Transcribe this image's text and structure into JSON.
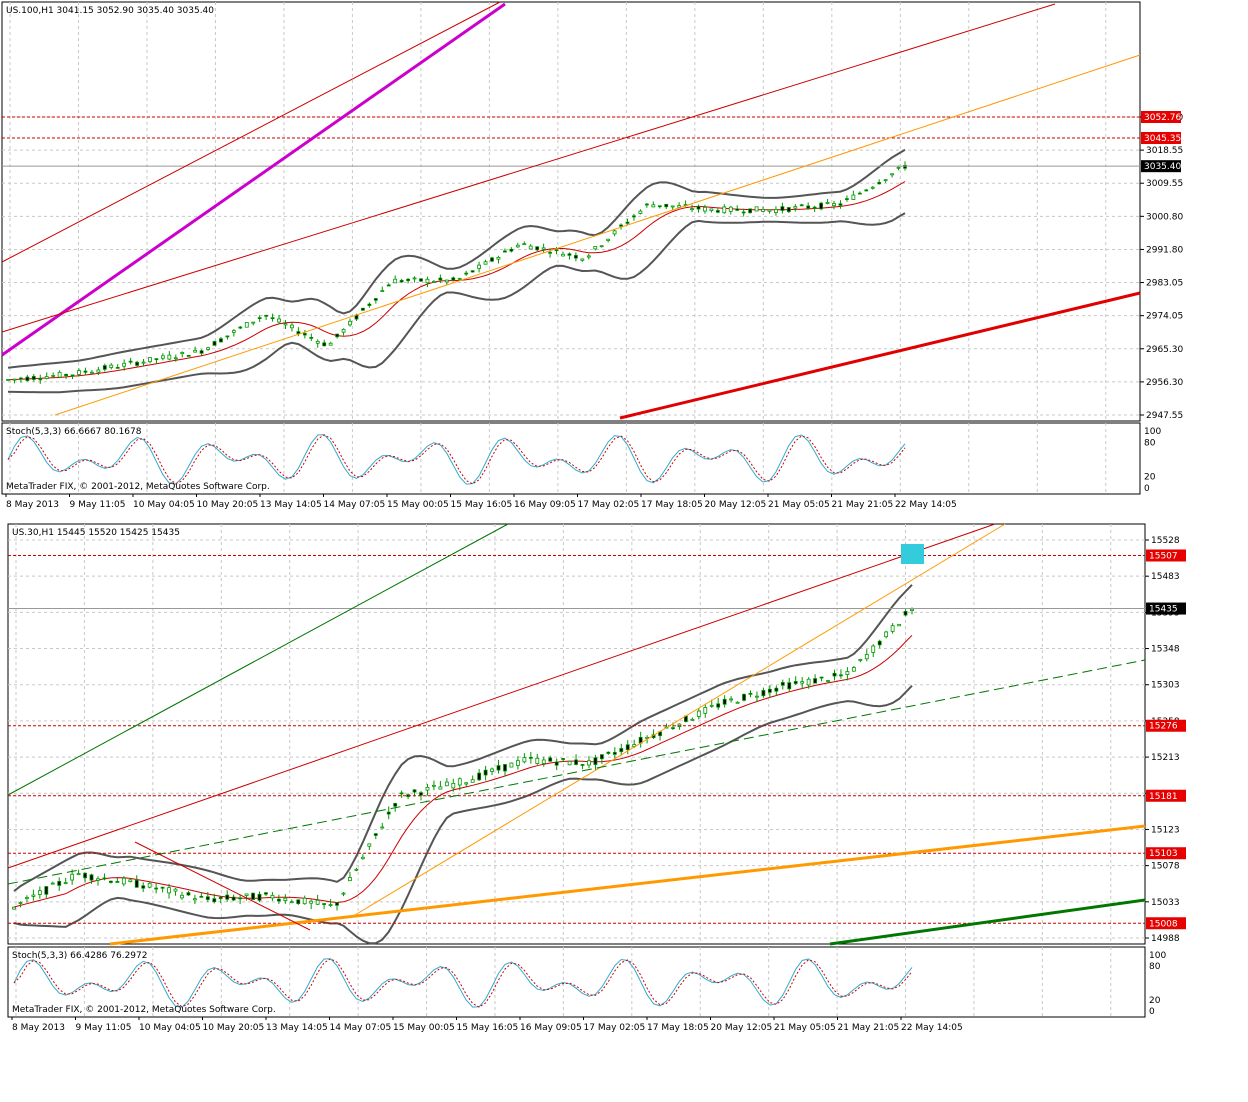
{
  "charts": [
    {
      "id": "top",
      "header": "US.100,H1  3041.15 3052.90 3035.40 3035.40",
      "y_ticks": [
        "2947.55",
        "2956.30",
        "2965.30",
        "2974.05",
        "2983.05",
        "2991.80",
        "3000.80",
        "3009.55",
        "3018.55",
        "3027.30"
      ],
      "price_tags": [
        {
          "text": "3052.76",
          "kind": "red"
        },
        {
          "text": "3045.35",
          "kind": "red"
        },
        {
          "text": "3035.40",
          "kind": "black"
        }
      ],
      "stoch_label": "Stoch(5,3,3) 66.6667 80.1678",
      "stoch_levels": [
        "100",
        "80",
        "20",
        "0"
      ],
      "watermark": "MetaTrader FIX, © 2001-2012, MetaQuotes Software Corp.",
      "x_labels": [
        "8 May 2013",
        "9 May 11:05",
        "10 May 04:05",
        "10 May 20:05",
        "13 May 14:05",
        "14 May 07:05",
        "15 May 00:05",
        "15 May 16:05",
        "16 May 09:05",
        "17 May 02:05",
        "17 May 18:05",
        "20 May 12:05",
        "21 May 05:05",
        "21 May 21:05",
        "22 May 14:05"
      ]
    },
    {
      "id": "bottom",
      "header": "US.30,H1  15445 15520 15425 15435",
      "y_ticks": [
        "14988",
        "15033",
        "15078",
        "15123",
        "15168",
        "15213",
        "15258",
        "15303",
        "15348",
        "15393",
        "15483",
        "15528"
      ],
      "price_tags": [
        {
          "text": "15507",
          "kind": "red"
        },
        {
          "text": "15435",
          "kind": "black"
        },
        {
          "text": "15276",
          "kind": "red"
        },
        {
          "text": "15181",
          "kind": "red"
        },
        {
          "text": "15103",
          "kind": "red"
        },
        {
          "text": "15008",
          "kind": "red"
        }
      ],
      "stoch_label": "Stoch(5,3,3) 66.4286 76.2972",
      "stoch_levels": [
        "100",
        "80",
        "20",
        "0"
      ],
      "watermark": "MetaTrader FIX, © 2001-2012, MetaQuotes Software Corp.",
      "x_labels": [
        "8 May 2013",
        "9 May 11:05",
        "10 May 04:05",
        "10 May 20:05",
        "13 May 14:05",
        "14 May 07:05",
        "15 May 00:05",
        "15 May 16:05",
        "16 May 09:05",
        "17 May 02:05",
        "17 May 18:05",
        "20 May 12:05",
        "21 May 05:05",
        "21 May 21:05",
        "22 May 14:05"
      ]
    }
  ],
  "chart_data": [
    {
      "type": "line",
      "title": "US.100,H1",
      "ylim": [
        2947.55,
        3052.76
      ],
      "x": [
        "8 May 2013",
        "9 May 11:05",
        "10 May 04:05",
        "10 May 20:05",
        "13 May 14:05",
        "14 May 07:05",
        "15 May 00:05",
        "15 May 16:05",
        "16 May 09:05",
        "17 May 02:05",
        "17 May 18:05",
        "20 May 12:05",
        "21 May 05:05",
        "21 May 21:05",
        "22 May 14:05"
      ],
      "series": [
        {
          "values": [
            2960,
            2962,
            2966,
            2970,
            2983,
            2972,
            2995,
            2995,
            3008,
            3003,
            3022,
            3020,
            3020,
            3022,
            3035.4
          ]
        }
      ],
      "colors": {
        "candle": "#009900",
        "bands": "#555555",
        "ma": "#cc0000",
        "stoch_main": "#33aacc",
        "stoch_signal": "#cc0000"
      }
    },
    {
      "type": "line",
      "title": "US.30,H1",
      "ylim": [
        14988,
        15528
      ],
      "x": [
        "8 May 2013",
        "9 May 11:05",
        "10 May 04:05",
        "10 May 20:05",
        "13 May 14:05",
        "14 May 07:05",
        "15 May 00:05",
        "15 May 16:05",
        "16 May 09:05",
        "17 May 02:05",
        "17 May 18:05",
        "20 May 12:05",
        "21 May 05:05",
        "21 May 21:05",
        "22 May 14:05"
      ],
      "series": [
        {
          "values": [
            15030,
            15075,
            15060,
            15040,
            15045,
            15030,
            15180,
            15200,
            15230,
            15225,
            15265,
            15305,
            15330,
            15345,
            15435
          ]
        }
      ],
      "colors": {
        "candle": "#009900",
        "bands": "#555555",
        "ma": "#cc0000",
        "stoch_main": "#33aacc",
        "stoch_signal": "#cc0000"
      }
    }
  ]
}
